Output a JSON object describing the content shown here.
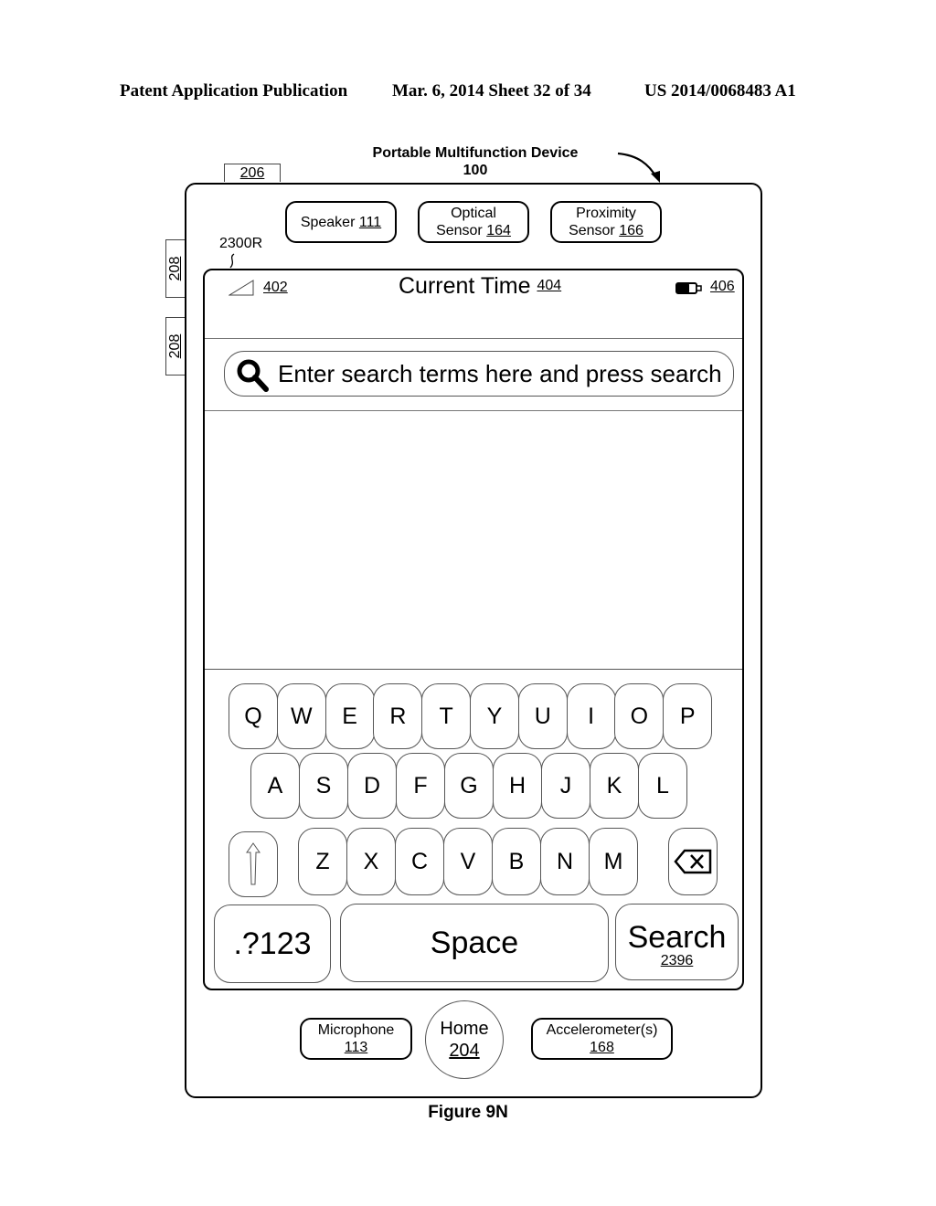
{
  "header": {
    "publication": "Patent Application Publication",
    "date_sheet": "Mar. 6, 2014   Sheet 32 of 34",
    "patent_number": "US 2014/0068483 A1"
  },
  "device": {
    "title": "Portable Multifunction Device",
    "ref": "100",
    "tab_ref": "206",
    "side_buttons": [
      "208",
      "208"
    ],
    "ui_ref": "2300R"
  },
  "sensors_top": [
    {
      "label": "Speaker",
      "ref": "111"
    },
    {
      "label": "Optical",
      "label2": "Sensor",
      "ref": "164"
    },
    {
      "label": "Proximity",
      "label2": "Sensor",
      "ref": "166"
    }
  ],
  "status_bar": {
    "signal_icon": "signal-strength-icon",
    "signal_ref": "402",
    "time_label": "Current Time",
    "time_ref": "404",
    "battery_icon": "battery-icon",
    "battery_ref": "406"
  },
  "search": {
    "icon": "magnifier-icon",
    "placeholder": "Enter search terms here and press search"
  },
  "keyboard": {
    "row1": [
      "Q",
      "W",
      "E",
      "R",
      "T",
      "Y",
      "U",
      "I",
      "O",
      "P"
    ],
    "row2": [
      "A",
      "S",
      "D",
      "F",
      "G",
      "H",
      "J",
      "K",
      "L"
    ],
    "row3": [
      "Z",
      "X",
      "C",
      "V",
      "B",
      "N",
      "M"
    ],
    "shift_icon": "shift-arrow-icon",
    "backspace_icon": "backspace-icon",
    "numbers_label": ".?123",
    "space_label": "Space",
    "search_label": "Search",
    "search_ref": "2396"
  },
  "sensors_bottom": [
    {
      "label": "Microphone",
      "ref": "113"
    },
    {
      "label": "Home",
      "ref": "204"
    },
    {
      "label": "Accelerometer(s)",
      "ref": "168"
    }
  ],
  "figure_caption": "Figure 9N"
}
